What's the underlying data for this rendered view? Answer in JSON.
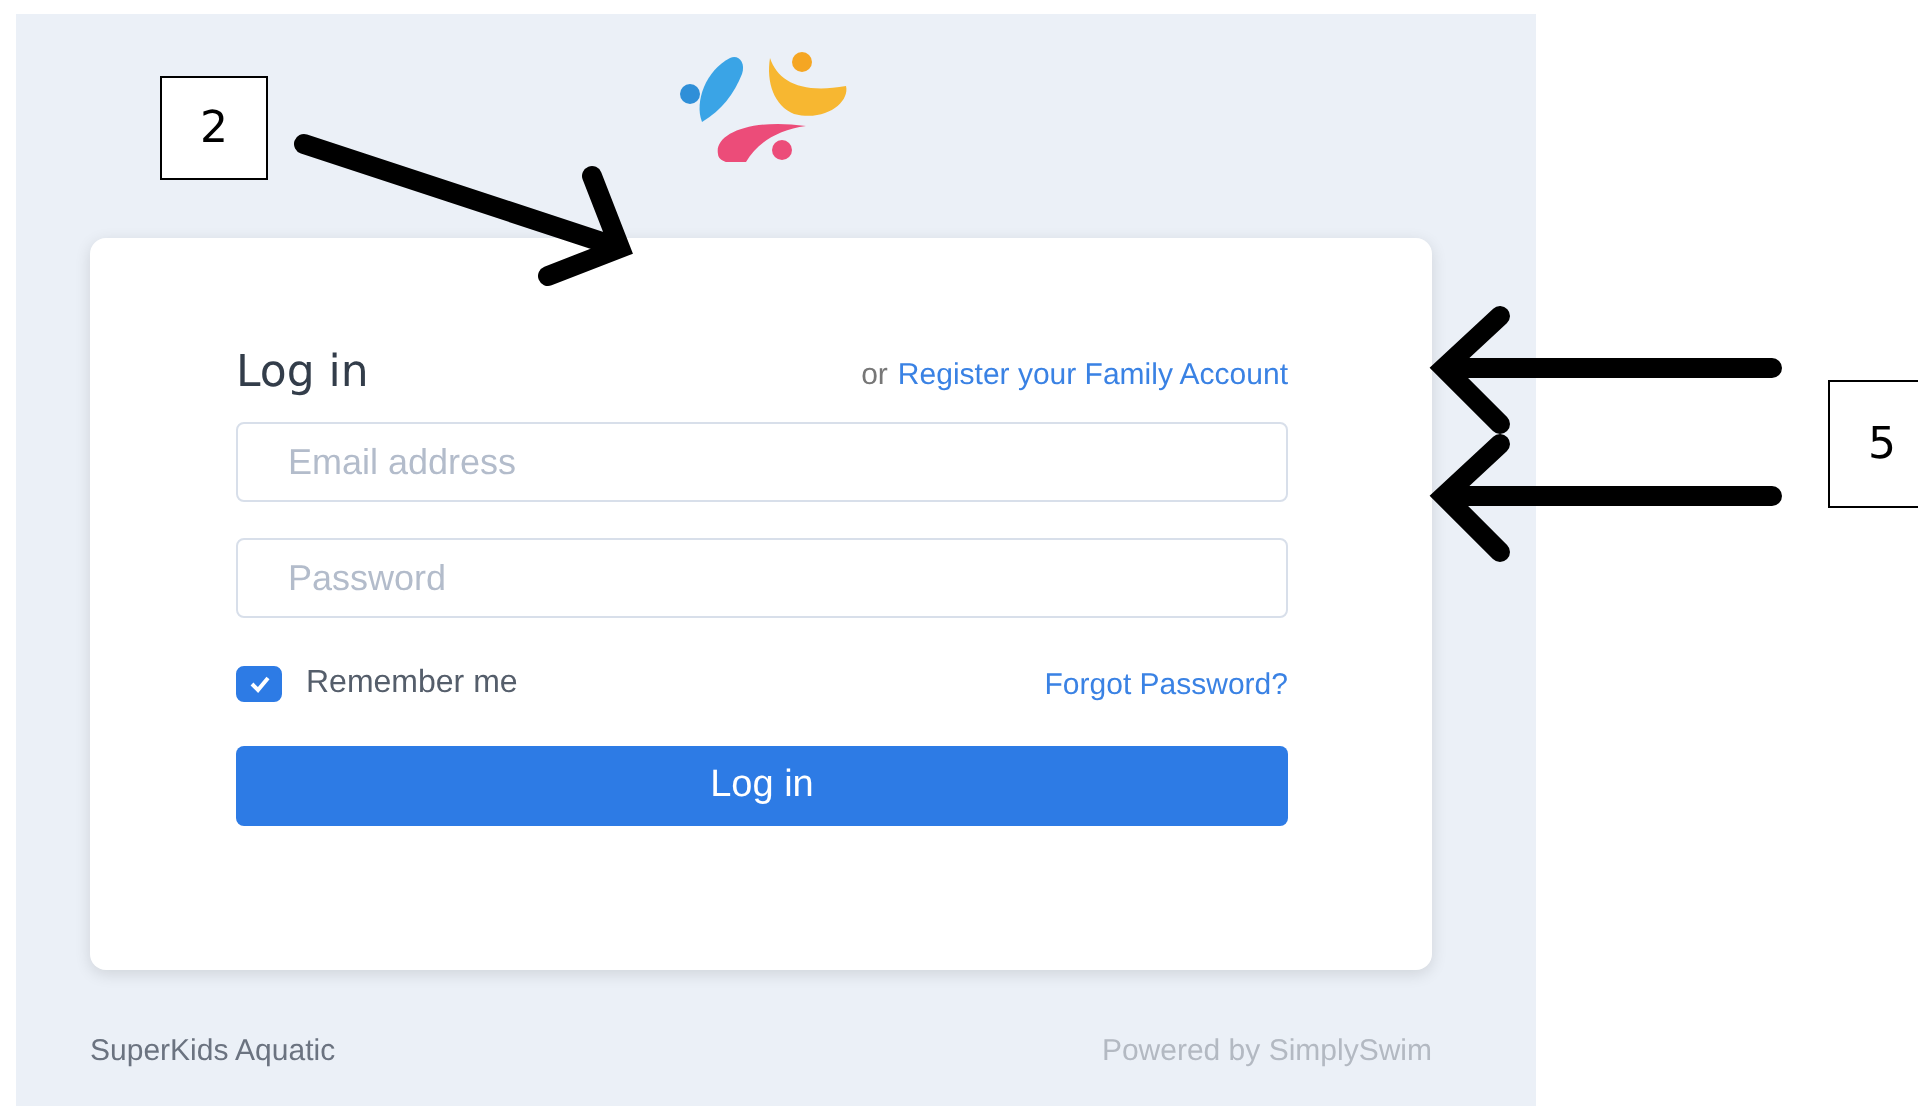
{
  "login": {
    "title": "Log in",
    "register_prefix": "or",
    "register_link": "Register your Family Account",
    "email": {
      "placeholder": "Email address"
    },
    "password": {
      "placeholder": "Password"
    },
    "remember": {
      "label": "Remember me",
      "checked": true
    },
    "forgot_link": "Forgot Password?",
    "submit": "Log in"
  },
  "footer": {
    "left": "SuperKids Aquatic",
    "right": "Powered by SimplySwim"
  },
  "annotations": [
    {
      "label": "2"
    },
    {
      "label": "5"
    }
  ]
}
